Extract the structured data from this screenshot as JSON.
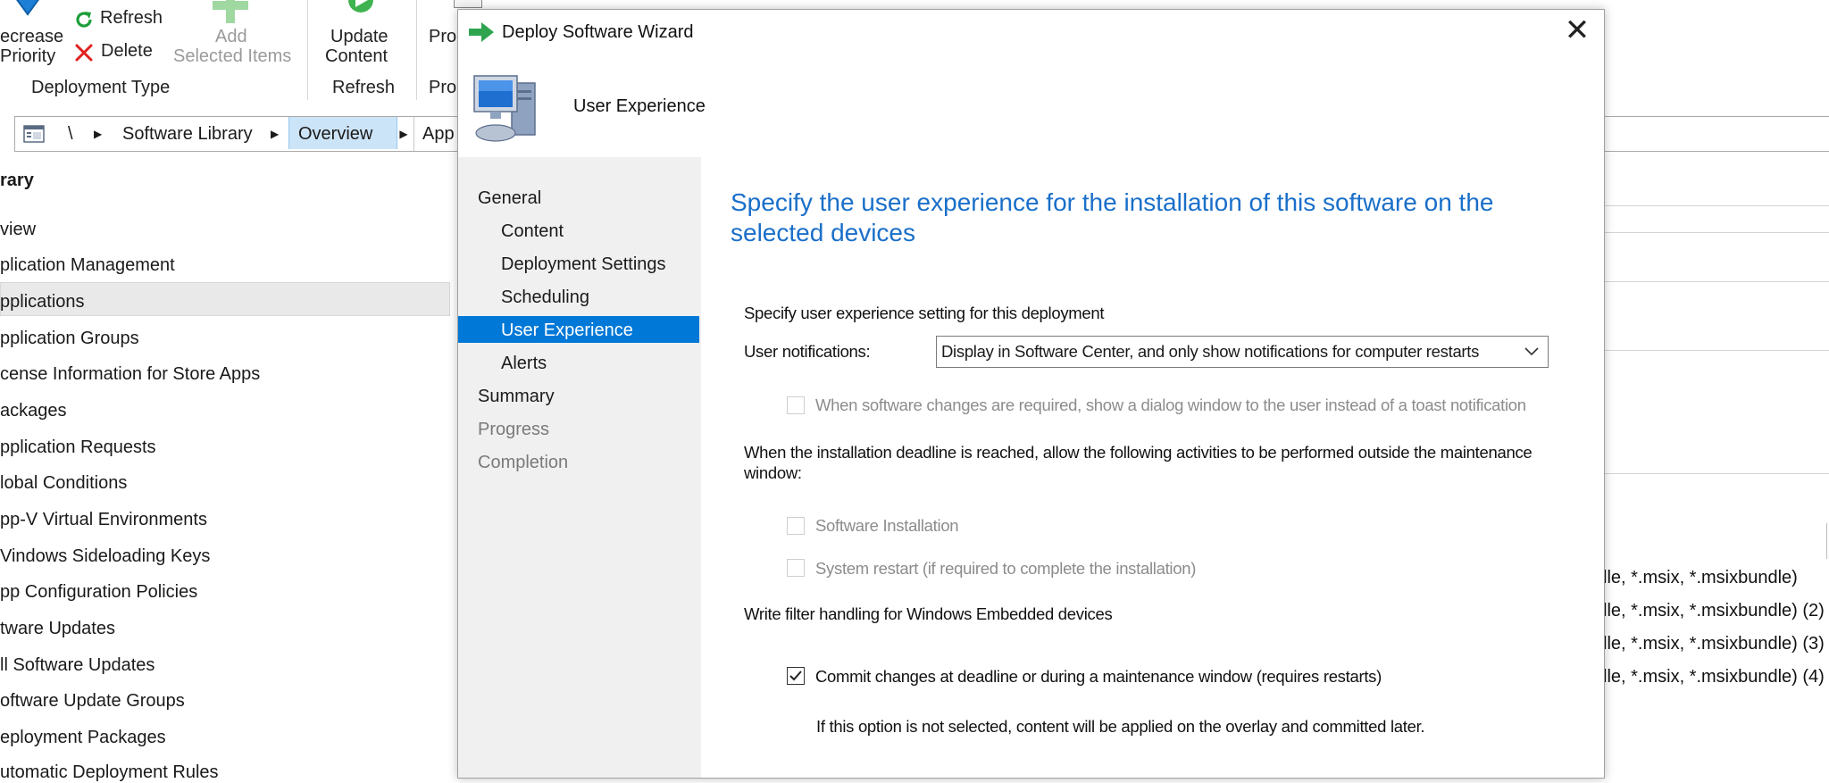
{
  "ribbon": {
    "increase_priority_line1": "ecrease",
    "increase_priority_line2": "Priority",
    "refresh_label": "Refresh",
    "delete_label": "Delete",
    "add_selected_line1": "Add",
    "add_selected_line2": "Selected Items",
    "update_content_line1": "Update",
    "update_content_line2": "Content",
    "pro_label": "Pro",
    "group_deployment_type": "Deployment Type",
    "group_refresh": "Refresh",
    "group_pro": "Pro"
  },
  "breadcrumb": {
    "root": "\\",
    "software_library": "Software Library",
    "overview": "Overview",
    "app": "App"
  },
  "leftnav": {
    "items": [
      "rary",
      "view",
      "plication Management",
      "pplications",
      "pplication Groups",
      "cense Information for Store Apps",
      "ackages",
      "pplication Requests",
      "lobal Conditions",
      "pp-V Virtual Environments",
      "Vindows Sideloading Keys",
      "pp Configuration Policies",
      "tware Updates",
      "ll Software Updates",
      "oftware Update Groups",
      "eployment Packages",
      "utomatic Deployment Rules"
    ]
  },
  "rightpane": {
    "rows": [
      "lle, *.msix, *.msixbundle)",
      "lle, *.msix, *.msixbundle) (2)",
      "lle, *.msix, *.msixbundle) (3)",
      "lle, *.msix, *.msixbundle) (4)"
    ]
  },
  "dialog": {
    "title": "Deploy Software Wizard",
    "close_glyph": "✕",
    "header": "User Experience",
    "steps": [
      {
        "label": "General",
        "state": "normal"
      },
      {
        "label": "Content",
        "state": "normal"
      },
      {
        "label": "Deployment Settings",
        "state": "normal"
      },
      {
        "label": "Scheduling",
        "state": "normal"
      },
      {
        "label": "User Experience",
        "state": "selected"
      },
      {
        "label": "Alerts",
        "state": "normal"
      },
      {
        "label": "Summary",
        "state": "normal"
      },
      {
        "label": "Progress",
        "state": "disabled"
      },
      {
        "label": "Completion",
        "state": "disabled"
      }
    ],
    "content": {
      "title": "Specify the user experience for the installation of this software on the selected devices",
      "intro": "Specify user experience setting for this deployment",
      "notifications_label": "User notifications:",
      "notifications_value": "Display in Software Center, and only show notifications for computer restarts",
      "dialog_window_option": "When software changes are required, show a dialog window to the user instead of a toast notification",
      "deadline_text_line1": "When the installation deadline is reached, allow the following activities to be performed outside the maintenance",
      "deadline_text_line2": "window:",
      "software_installation": "Software Installation",
      "system_restart": "System restart  (if required to complete the installation)",
      "write_filter_heading": "Write filter handling for Windows Embedded devices",
      "commit_changes": "Commit changes at deadline or during a maintenance window (requires restarts)",
      "commit_note": "If this option is not selected, content will be applied on the overlay and committed later."
    }
  },
  "colors": {
    "accent_blue": "#0078d7",
    "title_blue": "#1a6fc9",
    "delete_red": "#e02020",
    "refresh_green": "#1e9e3a"
  }
}
